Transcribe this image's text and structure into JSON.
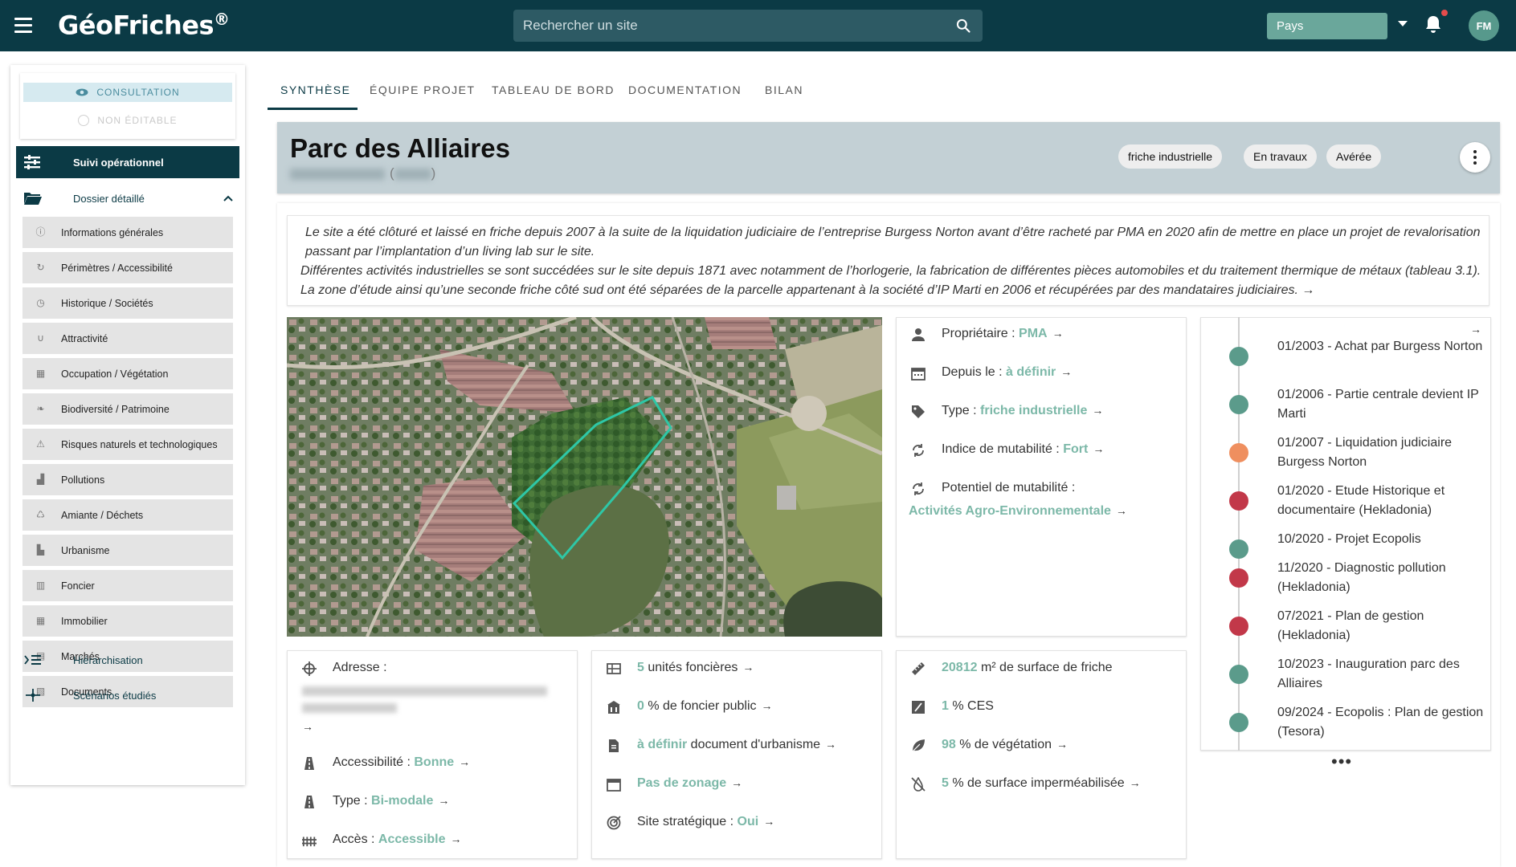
{
  "app": {
    "logo_text": "GéoFriches",
    "logo_reg": "®",
    "search_placeholder": "Rechercher un site",
    "country_label": "Pays",
    "user_initials": "FM"
  },
  "sidebar": {
    "mode_consultation": "CONSULTATION",
    "mode_non_editable": "NON ÉDITABLE",
    "suivi_label": "Suivi opérationnel",
    "dossier_label": "Dossier détaillé",
    "sub_items": [
      {
        "label": "Informations générales",
        "icon": "info-icon"
      },
      {
        "label": "Périmètres / Accessibilité",
        "icon": "refresh-icon"
      },
      {
        "label": "Historique / Sociétés",
        "icon": "history-icon"
      },
      {
        "label": "Attractivité",
        "icon": "magnet-icon"
      },
      {
        "label": "Occupation / Végétation",
        "icon": "building-icon"
      },
      {
        "label": "Biodiversité / Patrimoine",
        "icon": "leaf-icon"
      },
      {
        "label": "Risques naturels et technologiques",
        "icon": "warning-icon"
      },
      {
        "label": "Pollutions",
        "icon": "factory-icon"
      },
      {
        "label": "Amiante / Déchets",
        "icon": "recycle-icon"
      },
      {
        "label": "Urbanisme",
        "icon": "city-icon"
      },
      {
        "label": "Foncier",
        "icon": "plan-icon"
      },
      {
        "label": "Immobilier",
        "icon": "building-icon"
      },
      {
        "label": "Marchés",
        "icon": "document-icon"
      },
      {
        "label": "Documents",
        "icon": "files-icon"
      }
    ],
    "hierarchisation_label": "Hiérarchisation",
    "scenarios_label": "Scénarios étudiés"
  },
  "tabs": [
    "SYNTHÈSE",
    "ÉQUIPE PROJET",
    "TABLEAU DE BORD",
    "DOCUMENTATION",
    "BILAN"
  ],
  "header": {
    "title": "Parc des Alliaires",
    "subtitle_open": "(",
    "subtitle_close": ")",
    "chips": [
      "friche industrielle",
      "En travaux",
      "Avérée"
    ]
  },
  "description": {
    "line1": "Le site a été clôturé et laissé en friche depuis 2007 à la suite de la liquidation judiciaire de l’entreprise Burgess Norton avant d’être racheté par PMA en 2020 afin de mettre en place un projet de revalorisation passant par l’implantation d’un living lab sur le site.",
    "line2": "Différentes activités industrielles se sont succédées sur le site depuis 1871 avec notamment de l’horlogerie, la fabrication de différentes pièces automobiles et du traitement thermique de métaux (tableau 3.1).  La zone d’étude ainsi qu’une seconde friche côté sud ont été séparées de la parcelle appartenant à la société d’IP Marti en 2006 et récupérées par des mandataires judiciaires."
  },
  "info_card": {
    "owner_label": "Propriétaire : ",
    "owner_value": "PMA",
    "since_label": "Depuis le : ",
    "since_value": "à définir",
    "type_label": "Type : ",
    "type_value": "friche industrielle",
    "mutability_label": "Indice de mutabilité : ",
    "mutability_value": "Fort",
    "potential_label": "Potentiel de mutabilité :",
    "potential_value": "Activités Agro-Environnementale"
  },
  "address_card": {
    "address_label": "Adresse :",
    "access_label": "Accessibilité : ",
    "access_value": "Bonne",
    "type_label": "Type : ",
    "type_value": "Bi-modale",
    "entry_label": "Accès : ",
    "entry_value": "Accessible"
  },
  "land_card": {
    "units_value": "5",
    "units_label": " unités foncières",
    "public_value": "0",
    "public_label": " % de foncier public",
    "urban_value": "à définir",
    "urban_label": " document d'urbanisme",
    "zoning_value": "Pas de zonage",
    "strategic_label": "Site stratégique : ",
    "strategic_value": "Oui"
  },
  "surface_card": {
    "surface_value": "20812",
    "surface_label": " m² de surface de friche",
    "ces_value": "1",
    "ces_label": " % CES",
    "veg_value": "98",
    "veg_label": " % de végétation",
    "imperm_value": "5",
    "imperm_label": " % de surface imperméabilisée"
  },
  "timeline": [
    {
      "text": "01/2003   -   Achat par Burgess Norton",
      "color": "#5b9b8b"
    },
    {
      "text": "01/2006   -   Partie centrale devient IP Marti",
      "color": "#5b9b8b"
    },
    {
      "text": "01/2007   -   Liquidation judiciaire Burgess Norton",
      "color": "#ef8f5f"
    },
    {
      "text": "01/2020   -   Etude Historique et documentaire (Hekladonia)",
      "color": "#c23849"
    },
    {
      "text": "10/2020   -   Projet Ecopolis",
      "color": "#5b9b8b"
    },
    {
      "text": "11/2020   -   Diagnostic pollution (Hekladonia)",
      "color": "#c23849"
    },
    {
      "text": "07/2021   -   Plan de gestion (Hekladonia)",
      "color": "#c23849"
    },
    {
      "text": "10/2023   -   Inauguration parc des Alliaires",
      "color": "#5b9b8b"
    },
    {
      "text": "09/2024   -   Ecopolis : Plan de gestion (Tesora)",
      "color": "#5b9b8b"
    }
  ],
  "colors": {
    "primary": "#0b3a45",
    "accent": "#7cb8a8",
    "header_bg": "#c3d0d5"
  }
}
